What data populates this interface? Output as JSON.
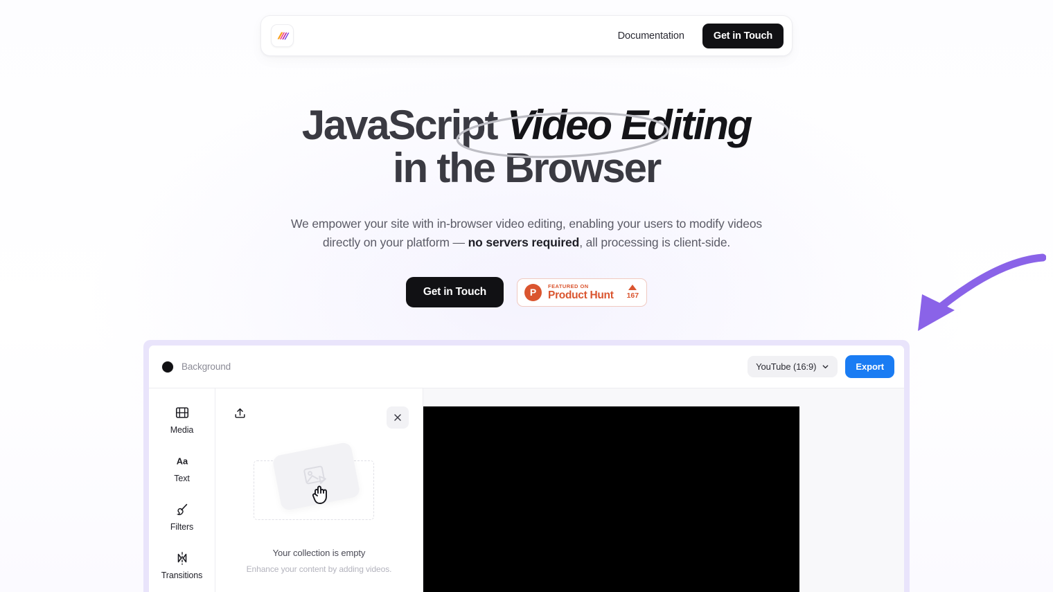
{
  "navbar": {
    "logo_icon": "app-logo-icon",
    "doc_link": "Documentation",
    "cta_label": "Get in Touch"
  },
  "hero": {
    "headline_part1": "JavaScript ",
    "headline_emph": "Video Editing",
    "headline_part2": " in the Browser",
    "subtitle_line1": "We empower your site with in-browser video editing, enabling your users to modify videos",
    "subtitle_line2_a": "directly on your platform — ",
    "subtitle_line2_bold": "no servers required",
    "subtitle_line2_b": ", all processing is client-side.",
    "cta_label": "Get in Touch",
    "product_hunt": {
      "kicker": "FEATURED ON",
      "name": "Product Hunt",
      "votes": "167",
      "logo_letter": "P",
      "accent_color": "#da552f"
    },
    "arrow_color": "#8a63e8"
  },
  "editor": {
    "frame_color": "#e9e4fb",
    "topbar": {
      "background_swatch_color": "#111114",
      "background_label": "Background",
      "aspect_value": "YouTube (16:9)",
      "export_label": "Export",
      "export_color": "#1a7cf3"
    },
    "tools": [
      {
        "label": "Media",
        "icon": "film-icon"
      },
      {
        "label": "Text",
        "icon": "text-aa-icon"
      },
      {
        "label": "Filters",
        "icon": "brush-icon"
      },
      {
        "label": "Transitions",
        "icon": "transitions-icon"
      }
    ],
    "media_panel": {
      "upload_icon": "upload-icon",
      "close_icon": "close-icon",
      "empty_title": "Your collection is empty",
      "empty_subtitle": "Enhance your content by adding videos.",
      "placeholder_icon": "image-play-icon",
      "cursor_icon": "grabbing-hand-icon"
    },
    "canvas": {
      "background_color": "#000000"
    }
  }
}
